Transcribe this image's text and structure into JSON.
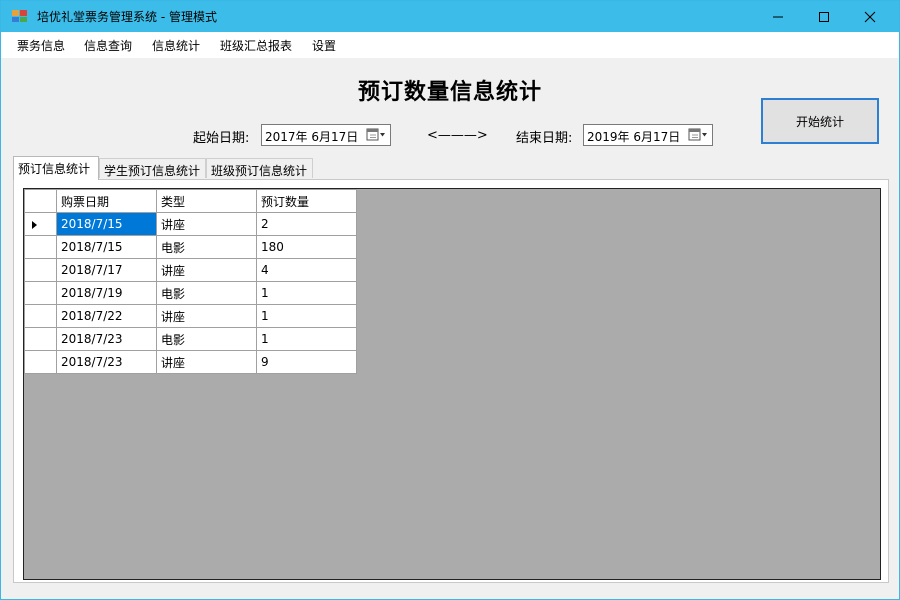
{
  "window": {
    "title": "培优礼堂票务管理系统 - 管理模式"
  },
  "menu": {
    "items": [
      "票务信息",
      "信息查询",
      "信息统计",
      "班级汇总报表",
      "设置"
    ]
  },
  "form": {
    "heading": "预订数量信息统计",
    "start_label": "起始日期:",
    "start_value": "2017年  6月17日",
    "arrow": "<———>",
    "end_label": "结束日期:",
    "end_value": "2019年  6月17日",
    "start_button": "开始统计"
  },
  "tabs": [
    "预订信息统计",
    "学生预订信息统计",
    "班级预订信息统计"
  ],
  "grid": {
    "columns": [
      "购票日期",
      "类型",
      "预订数量"
    ],
    "rows": [
      [
        "2018/7/15",
        "讲座",
        "2"
      ],
      [
        "2018/7/15",
        "电影",
        "180"
      ],
      [
        "2018/7/17",
        "讲座",
        "4"
      ],
      [
        "2018/7/19",
        "电影",
        "1"
      ],
      [
        "2018/7/22",
        "讲座",
        "1"
      ],
      [
        "2018/7/23",
        "电影",
        "1"
      ],
      [
        "2018/7/23",
        "讲座",
        "9"
      ]
    ]
  }
}
